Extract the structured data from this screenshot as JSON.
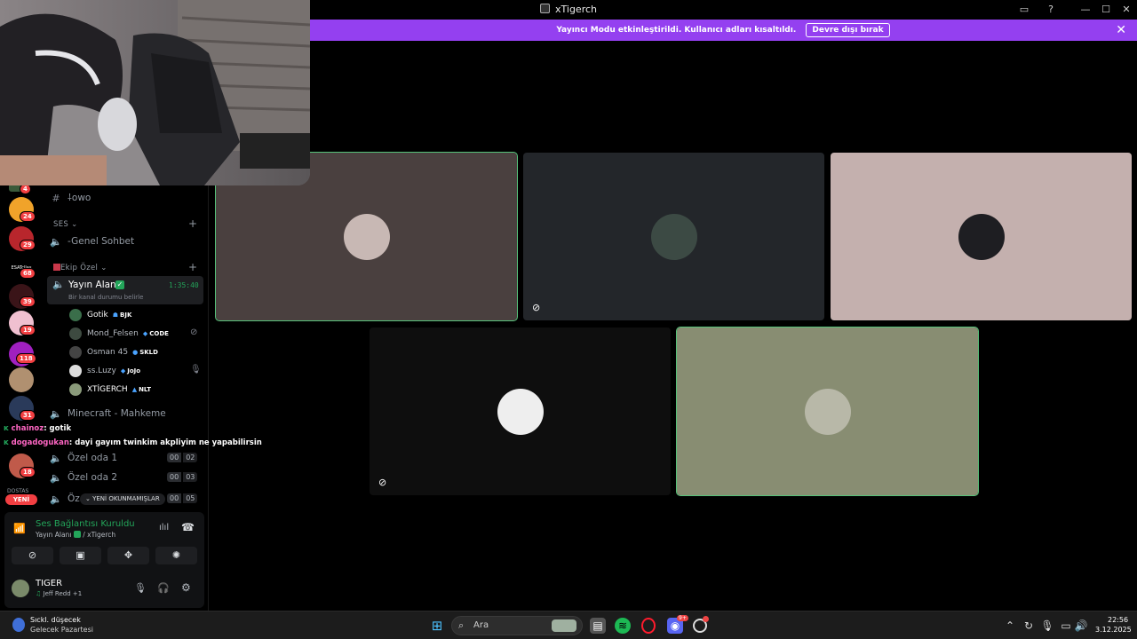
{
  "window": {
    "title": "xTigerch",
    "controls": [
      "▭",
      "?",
      "—",
      "☐",
      "✕"
    ]
  },
  "banner": {
    "text": "Yayıncı Modu etkinleştirildi. Kullanıcı adları kısaltıldı.",
    "button": "Devre dışı bırak",
    "close": "✕"
  },
  "servers": {
    "badges": [
      "4",
      "24",
      "29",
      "68",
      "39",
      "19",
      "118",
      "31",
      "18"
    ],
    "small_label": "ESATcllas",
    "footer_label": "DOSTAS",
    "new_button": "YENİ"
  },
  "channels": {
    "text_channel": "⸸owo",
    "cat_ses": "SES",
    "genel": "-Genel Sohbet",
    "cat_ekip": "Ekip Özel",
    "active_channel": "Yayın Alanı",
    "active_timer": "1:35:40",
    "active_status": "Bir kanal durumu belirle",
    "members": [
      {
        "name": "Gotik",
        "tag": "BJK",
        "tag_icon": "☗",
        "color": "#3a6e4a"
      },
      {
        "name": "Mond_Felsen",
        "tag": "CODE",
        "tag_icon": "◆",
        "color": "#3d4a40"
      },
      {
        "name": "Osman 45",
        "tag": "SKLD",
        "tag_icon": "●",
        "color": "#444"
      },
      {
        "name": "ss.Luzy",
        "tag": "JoJo",
        "tag_icon": "◆",
        "color": "#ddd"
      },
      {
        "name": "XTİGERCH",
        "tag": "NLT",
        "tag_icon": "▲",
        "color": "#8a9a7a"
      }
    ],
    "minecraft": "Minecraft - Mahkeme",
    "ozel1": "Özel oda 1",
    "ozel1_count": [
      "00",
      "02"
    ],
    "ozel2": "Özel oda 2",
    "ozel2_count": [
      "00",
      "03"
    ],
    "ozel3": "Öz",
    "ozel3_count": [
      "00",
      "05"
    ],
    "unread_pill": "YENİ OKUNMAMIŞLAR"
  },
  "chat_overlay": [
    {
      "user": "chainoz",
      "text": ": gotik"
    },
    {
      "user": "dogadogukan",
      "text": ": dayi gayım twinkim akpliyim ne yapabilirsin"
    }
  ],
  "voice": {
    "status": "Ses Bağlantısı Kuruldu",
    "channel": "Yayın Alanı",
    "server": "/ xTigerch"
  },
  "user": {
    "name": "TIGER",
    "activity": "Jeff Redd +1"
  },
  "tiles": [
    {
      "bg": "#4a403f",
      "avatar": "#c8b8b4",
      "speaking": true,
      "muted": false
    },
    {
      "bg": "#23262a",
      "avatar": "#3c4a44",
      "speaking": false,
      "muted": true
    },
    {
      "bg": "#c4b0ae",
      "avatar": "#1e1e22",
      "speaking": false,
      "muted": false
    },
    {
      "bg": "#0e0e0e",
      "avatar": "#eeeeee",
      "speaking": false,
      "muted": true
    },
    {
      "bg": "#888d72",
      "avatar": "#b8b8a8",
      "speaking": true,
      "muted": false
    }
  ],
  "taskbar": {
    "weather_title": "Sıckl. düşecek",
    "weather_sub": "Gelecek Pazartesi",
    "search_placeholder": "Ara",
    "time": "22:56",
    "date": "3.12.2025",
    "discord_badge": "9+"
  },
  "colors": {
    "banner": "#9440f0",
    "speaking": "#56c27a",
    "connected": "#23a55a"
  }
}
